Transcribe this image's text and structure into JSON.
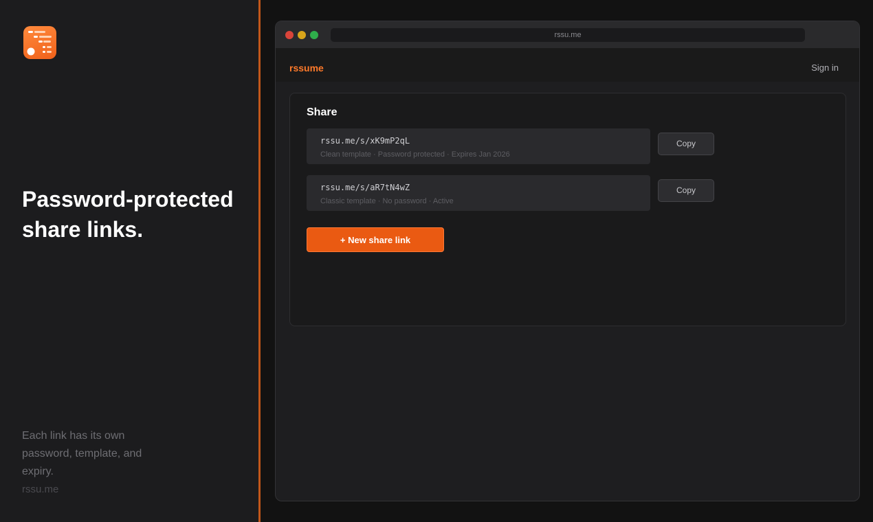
{
  "promo": {
    "headline": "Password-protected share links.",
    "description": "Each link has its own password, template, and expiry.",
    "domain": "rssu.me"
  },
  "browser": {
    "url": "rssu.me"
  },
  "nav": {
    "brand": "rssume",
    "sign_in": "Sign in"
  },
  "share": {
    "title": "Share",
    "links": [
      {
        "url": "rssu.me/s/xK9mP2qL",
        "meta": "Clean template · Password protected · Expires Jan 2026",
        "copy_label": "Copy"
      },
      {
        "url": "rssu.me/s/aR7tN4wZ",
        "meta": "Classic template · No password · Active",
        "copy_label": "Copy"
      }
    ],
    "new_link_label": "+ New share link"
  },
  "colors": {
    "accent": "#ea5a12",
    "brand": "#ff7a2a",
    "divider": "#c2571a"
  }
}
